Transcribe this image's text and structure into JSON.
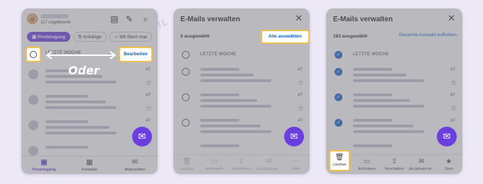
{
  "watermark": "CAN-EMAIL",
  "panel1": {
    "unread": "117 ungelesene",
    "chips": [
      "Posteingang",
      "Anhänge",
      "Mit Stern mar"
    ],
    "section": "LETZTE WOCHE",
    "edit_label": "Bearbeiten",
    "or_label": "Oder",
    "rows": [
      {
        "date": "4T"
      },
      {
        "date": "4T"
      },
      {
        "date": "4T"
      },
      {
        "date": ""
      }
    ],
    "nav": [
      {
        "label": "Posteingang",
        "icon": "inbox-icon"
      },
      {
        "label": "Kontakte",
        "icon": "contacts-icon"
      },
      {
        "label": "Abbestellen",
        "icon": "unsubscribe-icon"
      }
    ]
  },
  "panel2": {
    "title": "E-Mails verwalten",
    "selected": "0 ausgewählt",
    "select_all": "Alle auswählen",
    "section": "LETZTE WOCHE",
    "rows": [
      {
        "date": "4T"
      },
      {
        "date": "4T"
      },
      {
        "date": "4T"
      },
      {
        "date": ""
      }
    ],
    "toolbar": [
      "Löschen",
      "Archivieren",
      "Verschieben",
      "Als ungelesen...",
      "Mehr"
    ]
  },
  "panel3": {
    "title": "E-Mails verwalten",
    "selected": "163 ausgewählt",
    "deselect_all": "Gesamte Auswahl aufheben",
    "section": "LETZTE WOCHE",
    "rows": [
      {
        "date": "4T"
      },
      {
        "date": "4T"
      },
      {
        "date": "4T"
      },
      {
        "date": ""
      }
    ],
    "toolbar": [
      "Löschen",
      "Archivieren",
      "Verschieben",
      "Als gelesen m...",
      "Stern"
    ]
  },
  "colors": {
    "accent": "#6b3ee0",
    "link": "#0e5fc7",
    "highlight": "#f3bf4c",
    "check": "#1963c9"
  }
}
